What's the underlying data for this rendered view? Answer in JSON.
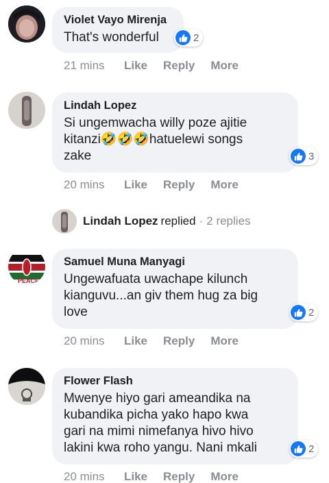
{
  "comments": [
    {
      "author": "Violet Vayo Mirenja",
      "lines": [
        "That's wonderful"
      ],
      "reaction_count": "2",
      "time": "21 mins",
      "actions": [
        "Like",
        "Reply",
        "More"
      ]
    },
    {
      "author": "Lindah Lopez",
      "lines": [
        "Si ungemwacha willy poze ajitie",
        "kitanzi🤣🤣🤣hatuelewi songs",
        "zake"
      ],
      "reaction_count": "3",
      "time": "20 mins",
      "actions": [
        "Like",
        "Reply",
        "More"
      ]
    },
    {
      "author": "Samuel Muna Manyagi",
      "lines": [
        "Ungewafuata uwachape kilunch",
        "kianguvu...an giv them hug za big",
        "love"
      ],
      "reaction_count": "2",
      "time": "20 mins",
      "actions": [
        "Like",
        "Reply",
        "More"
      ]
    },
    {
      "author": "Flower Flash",
      "lines": [
        "Mwenye hiyo gari ameandika na",
        "kubandika picha yako hapo kwa",
        "gari na mimi nimefanya hivo hivo",
        "lakini kwa roho yangu. Nani mkali"
      ],
      "reaction_count": "2",
      "time": "20 mins",
      "actions": [
        "Like",
        "Reply",
        "More"
      ]
    }
  ],
  "replies_summary": {
    "name": "Lindah Lopez",
    "verb": "replied",
    "separator": "·",
    "count": "2 replies"
  },
  "colors": {
    "bubble": "#f0f2f5",
    "like_blue": "#1877f2",
    "meta_gray": "#8a8d91"
  },
  "icons": [
    "like-thumb-icon"
  ]
}
